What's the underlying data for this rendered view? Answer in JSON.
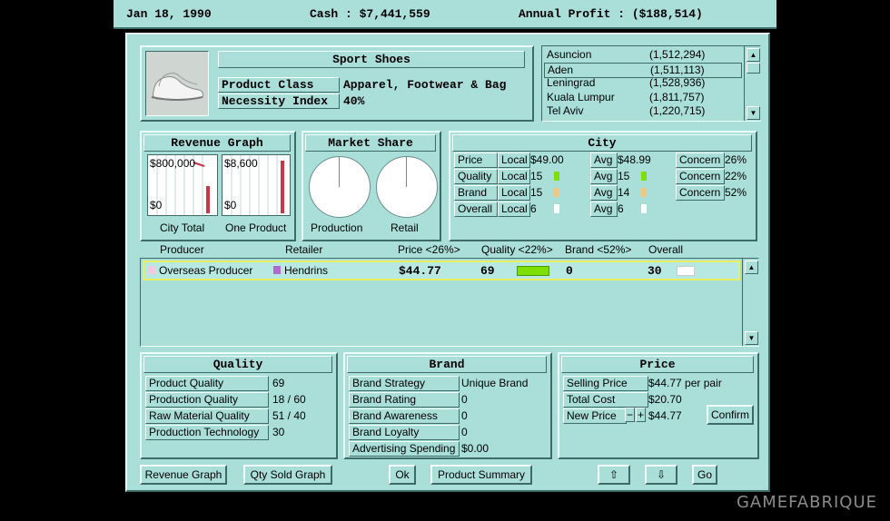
{
  "top": {
    "date": "Jan 18, 1990",
    "cash": "Cash : $7,441,559",
    "profit": "Annual Profit : ($188,514)"
  },
  "product": {
    "name": "Sport Shoes",
    "class_label": "Product Class",
    "class_value": "Apparel, Footwear & Bag",
    "necessity_label": "Necessity Index",
    "necessity_value": "40%"
  },
  "cities": [
    {
      "name": "Asuncion",
      "pop": "(1,512,294)"
    },
    {
      "name": "Aden",
      "pop": "(1,511,113)"
    },
    {
      "name": "Leningrad",
      "pop": "(1,528,936)"
    },
    {
      "name": "Kuala Lumpur",
      "pop": "(1,811,757)"
    },
    {
      "name": "Tel Aviv",
      "pop": "(1,220,715)"
    }
  ],
  "revenue": {
    "title": "Revenue Graph",
    "city_top": "$800,000",
    "city_bottom": "$0",
    "city_caption": "City Total",
    "prod_top": "$8,600",
    "prod_bottom": "$0",
    "prod_caption": "One Product"
  },
  "share": {
    "title": "Market Share",
    "production": "Production",
    "retail": "Retail"
  },
  "city": {
    "title": "City",
    "rows": [
      {
        "label": "Price",
        "local": "Local",
        "local_val": "$49.00",
        "avg": "Avg",
        "avg_val": "$48.99",
        "concern": "Concern",
        "concern_val": "26%"
      },
      {
        "label": "Quality",
        "local": "Local",
        "local_val": "15",
        "avg": "Avg",
        "avg_val": "15",
        "concern": "Concern",
        "concern_val": "22%"
      },
      {
        "label": "Brand",
        "local": "Local",
        "local_val": "15",
        "avg": "Avg",
        "avg_val": "14",
        "concern": "Concern",
        "concern_val": "52%"
      },
      {
        "label": "Overall",
        "local": "Local",
        "local_val": "6",
        "avg": "Avg",
        "avg_val": "6"
      }
    ]
  },
  "table": {
    "headers": {
      "producer": "Producer",
      "retailer": "Retailer",
      "price": "Price <26%>",
      "quality": "Quality <22%>",
      "brand": "Brand <52%>",
      "overall": "Overall"
    },
    "rows": [
      {
        "producer": "Overseas Producer",
        "retailer": "Hendrins",
        "price": "$44.77",
        "quality": "69",
        "brand": "0",
        "overall": "30"
      }
    ]
  },
  "quality": {
    "title": "Quality",
    "rows": [
      {
        "label": "Product Quality",
        "value": "69"
      },
      {
        "label": "Production Quality",
        "value": "18 / 60"
      },
      {
        "label": "Raw Material Quality",
        "value": "51 / 40"
      },
      {
        "label": "Production Technology",
        "value": "30"
      }
    ]
  },
  "brand": {
    "title": "Brand",
    "rows": [
      {
        "label": "Brand Strategy",
        "value": "Unique Brand"
      },
      {
        "label": "Brand Rating",
        "value": "0"
      },
      {
        "label": "Brand Awareness",
        "value": "0"
      },
      {
        "label": "Brand Loyalty",
        "value": "0"
      },
      {
        "label": "Advertising Spending",
        "value": "$0.00"
      }
    ]
  },
  "price": {
    "title": "Price",
    "selling_label": "Selling Price",
    "selling_value": "$44.77 per pair",
    "cost_label": "Total Cost",
    "cost_value": "$20.70",
    "new_label": "New Price",
    "minus": "−",
    "plus": "+",
    "new_value": "$44.77",
    "confirm": "Confirm"
  },
  "buttons": {
    "revenue_graph": "Revenue Graph",
    "qty_sold_graph": "Qty Sold Graph",
    "ok": "Ok",
    "product_summary": "Product Summary",
    "up": "⇧",
    "down": "⇩",
    "go": "Go"
  },
  "watermark": "GAMEFABRIQUE",
  "colors": {
    "bg": "#a9ded9",
    "bar_red": "#c8364a",
    "quality_bar": "#7ee000",
    "selection": "#e8f060"
  }
}
